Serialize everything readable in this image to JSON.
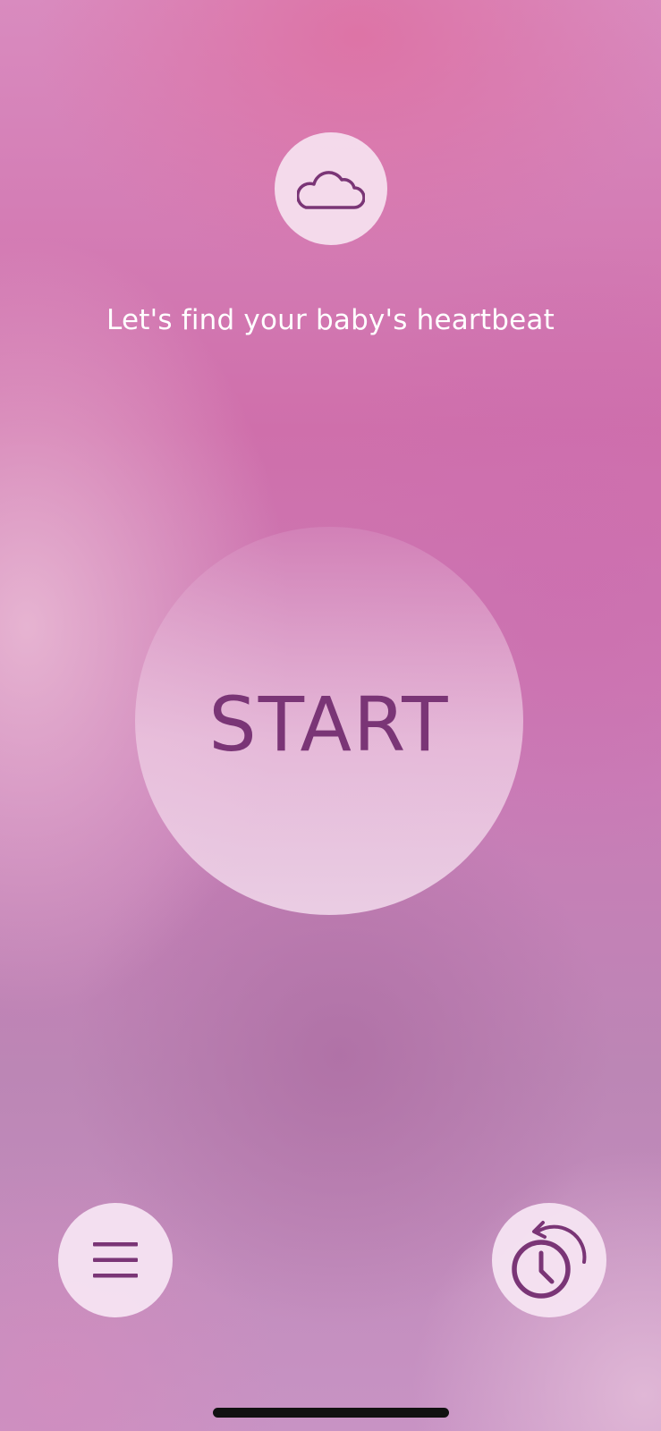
{
  "header": {
    "cloud_icon": "cloud-icon",
    "headline": "Let's find your baby's heartbeat"
  },
  "main": {
    "start_label": "START"
  },
  "footer": {
    "menu_icon": "menu-icon",
    "history_icon": "history-clock-icon"
  },
  "colors": {
    "accent": "#7a3576",
    "button_fill": "#f6e4f2",
    "headline_text": "#ffffff"
  }
}
